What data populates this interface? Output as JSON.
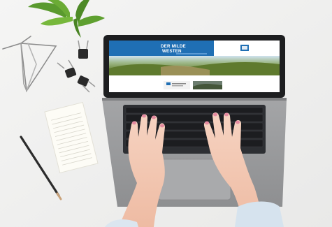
{
  "photo": {
    "website": {
      "title_line1": "DER MILDE",
      "title_line2": "WESTEN"
    }
  },
  "colors": {
    "desk": "#f1f1f0",
    "laptop_body": "#9a9b9d",
    "keyboard": "#2d2f33",
    "site_blue": "#1f6fb4",
    "skin": "#f3cbb7",
    "nail": "#e58aa0",
    "plant": "#5a9a2e"
  }
}
